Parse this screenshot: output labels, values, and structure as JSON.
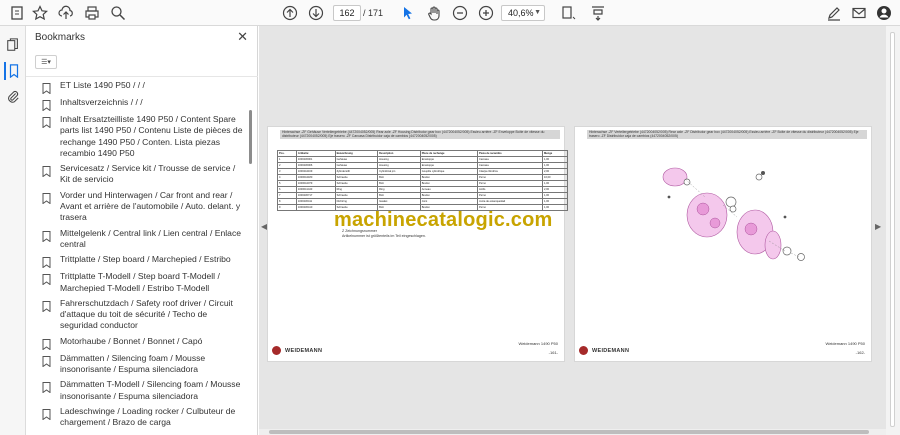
{
  "toolbar": {
    "page_current": "162",
    "page_total": "/ 171",
    "zoom": "40,6%",
    "icons": [
      "star-icon",
      "upload-icon",
      "print-icon",
      "search-icon",
      "prev-page-icon",
      "next-page-icon",
      "cursor-icon",
      "hand-icon",
      "zoom-out-icon",
      "zoom-in-icon",
      "fit-page-icon",
      "scroll-mode-icon",
      "sign-icon",
      "mail-icon",
      "account-icon"
    ]
  },
  "rail": {
    "icons": [
      "pages-icon",
      "bookmark-icon",
      "attachment-icon"
    ]
  },
  "bookmarks": {
    "title": "Bookmarks",
    "items": [
      "ET Liste 1490 P50 /  /  /",
      "Inhaltsverzeichnis /  /  /",
      "Inhalt Ersatzteilliste 1490 P50 / Content Spare parts list 1490 P50 / Contenu Liste de pièces de rechange 1490 P50 / Conten. Lista piezas recambio 1490 P50",
      "Servicesatz / Service kit / Trousse de service / Kit de servicio",
      "Vorder und Hinterwagen / Car front and rear / Avant et arrière de l'automobile / Auto. delant. y trasera",
      "Mittelgelenk / Central link / Lien central / Enlace central",
      "Trittplatte / Step board / Marchepied / Estribo",
      "Trittplatte T-Modell / Step board T-Modell / Marchepied T-Modell / Estribo T-Modell",
      "Fahrerschutzdach / Safety roof driver / Circuit d'attaque du toit de sécurité / Techo de seguridad conductor",
      "Motorhaube / Bonnet / Bonnet / Capó",
      "Dämmatten / Silencing foam / Mousse insonorisante / Espuma silenciadora",
      "Dämmatten T-Modell / Silencing foam / Mousse insonorisante / Espuma silenciadora",
      "Ladeschwinge / Loading rocker / Culbuteur de chargement / Brazo de carga"
    ]
  },
  "document": {
    "left_header": "Hinterachse -ZF Gehäuse Verteilergetriebe (4472004052/005) Rear axle -ZF Housing Distributor gear box (4472004052/005) Essieu arrière -ZF Enveloppe Boîte de vitesse du distributeur (4472004052/005) Eje trasero -ZF Carcasa Distribuidor caja de cambios (4472004052/005)",
    "right_header": "Hinterachse -ZF Verteilergetriebe (4472004052/005) Rear axle -ZF Distributor gear box (4472004052/005) Essieu arrière -ZF Boîte de vitesse du distributeur (4472004052/005) Eje trasero -ZF Distribuidor caja de cambios (4472004052/005)",
    "table_header": [
      "Pos.",
      "Artikelnr.",
      "Bezeichnung",
      "Description",
      "Pièce de rechange",
      "Pieza de recambio",
      "Menge"
    ],
    "table_rows": [
      [
        "1",
        "1000236001",
        "Gehäuse",
        "Housing",
        "Enveloppe",
        "Carcasa",
        "1,00"
      ],
      [
        "2",
        "1000236006",
        "Gehäuse",
        "Housing",
        "Enveloppe",
        "Carcasa",
        "1,00"
      ],
      [
        "3",
        "1000244169",
        "Zylinderstift",
        "Cylindrical pin",
        "Goupille cylindrique",
        "Clavija cilíndrica",
        "2,00"
      ],
      [
        "4",
        "1000044180",
        "Schraube",
        "Bolt",
        "Boulon",
        "Perno",
        "10,00"
      ],
      [
        "5",
        "1000044079",
        "Schraube",
        "Bolt",
        "Boulon",
        "Perno",
        "1,00"
      ],
      [
        "6",
        "1000041443",
        "Ring",
        "Ring",
        "Anneau",
        "Anillo",
        "2,00"
      ],
      [
        "7",
        "1000236717",
        "Schraube",
        "Bolt",
        "Boulon",
        "Perno",
        "1,00"
      ],
      [
        "8",
        "1000236411",
        "Dichtring",
        "Gasket",
        "Joint",
        "Junta de estanqueidad",
        "1,00"
      ],
      [
        "9",
        "1000236410",
        "Schraube",
        "Bolt",
        "Boulon",
        "Perno",
        "1,00"
      ]
    ],
    "notes": [
      "Z Zeichnungsnummer",
      "Artikelnummer ist größtenteils im Teil eingeschlagen."
    ],
    "brand": "WEIDEMANN",
    "model": "Weidemann 1490 P50",
    "left_page_no": "-161-",
    "right_page_no": "-162-",
    "watermark": "machinecatalogic.com"
  },
  "colors": {
    "accent": "#1473e6",
    "watermark": "#c8a400",
    "brand_red": "#a52a2a",
    "diagram_pink": "#e89ad8"
  }
}
